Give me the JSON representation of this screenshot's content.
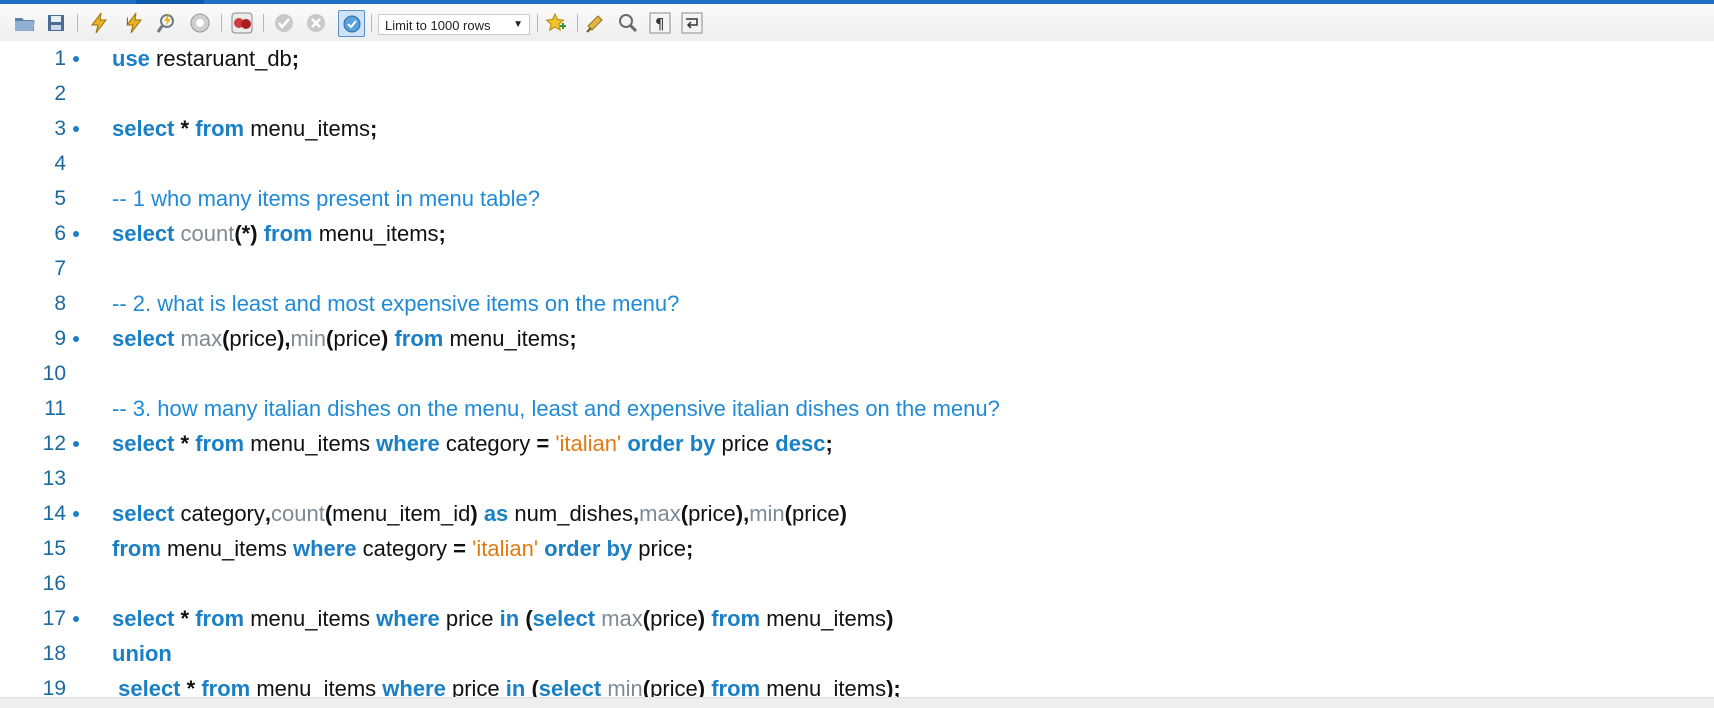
{
  "toolbar": {
    "limit_value": "Limit to 1000 rows",
    "buttons": [
      {
        "icon": "open-folder-icon",
        "label": "Open"
      },
      {
        "icon": "save-icon",
        "label": "Save"
      },
      {
        "icon": "execute-icon",
        "label": "Execute"
      },
      {
        "icon": "execute-current-icon",
        "label": "Execute current"
      },
      {
        "icon": "explain-icon",
        "label": "Explain"
      },
      {
        "icon": "stop-icon",
        "label": "Stop"
      },
      {
        "icon": "toggle-error-icon",
        "label": "Stop on error"
      },
      {
        "icon": "commit-icon",
        "label": "Commit"
      },
      {
        "icon": "rollback-icon",
        "label": "Rollback"
      },
      {
        "icon": "autocommit-icon",
        "label": "Autocommit"
      },
      {
        "icon": "snippet-icon",
        "label": "Add snippet"
      },
      {
        "icon": "beautify-icon",
        "label": "Beautify"
      },
      {
        "icon": "find-icon",
        "label": "Find"
      },
      {
        "icon": "invisible-chars-icon",
        "label": "Invisible characters"
      },
      {
        "icon": "wrap-icon",
        "label": "Word wrap"
      }
    ]
  },
  "colors": {
    "keyword": "#1a80c6",
    "function": "#7e8a93",
    "string": "#e27a12",
    "comment": "#1f8ad6",
    "line_number": "#1a6a9f",
    "accent": "#1f6fc4"
  },
  "editor": {
    "lines": [
      {
        "n": "1",
        "dot": true,
        "tokens": [
          [
            "kw",
            "use"
          ],
          [
            "id",
            " restaruant_db"
          ],
          [
            "pn",
            ";"
          ]
        ]
      },
      {
        "n": "2",
        "dot": false,
        "tokens": []
      },
      {
        "n": "3",
        "dot": true,
        "tokens": [
          [
            "kw",
            "select"
          ],
          [
            "pn",
            " * "
          ],
          [
            "kw",
            "from"
          ],
          [
            "id",
            " menu_items"
          ],
          [
            "pn",
            ";"
          ]
        ]
      },
      {
        "n": "4",
        "dot": false,
        "tokens": []
      },
      {
        "n": "5",
        "dot": false,
        "tokens": [
          [
            "cm",
            "-- 1 who many items present in menu table?"
          ]
        ]
      },
      {
        "n": "6",
        "dot": true,
        "tokens": [
          [
            "kw",
            "select"
          ],
          [
            "id",
            " "
          ],
          [
            "fn",
            "count"
          ],
          [
            "pn",
            "(*)"
          ],
          [
            "id",
            " "
          ],
          [
            "kw",
            "from"
          ],
          [
            "id",
            " menu_items"
          ],
          [
            "pn",
            ";"
          ]
        ]
      },
      {
        "n": "7",
        "dot": false,
        "tokens": []
      },
      {
        "n": "8",
        "dot": false,
        "tokens": [
          [
            "cm",
            "-- 2. what is least and most expensive items on the menu?"
          ]
        ]
      },
      {
        "n": "9",
        "dot": true,
        "tokens": [
          [
            "kw",
            "select"
          ],
          [
            "id",
            " "
          ],
          [
            "fn",
            "max"
          ],
          [
            "pn",
            "("
          ],
          [
            "id",
            "price"
          ],
          [
            "pn",
            "),"
          ],
          [
            "fn",
            "min"
          ],
          [
            "pn",
            "("
          ],
          [
            "id",
            "price"
          ],
          [
            "pn",
            ")"
          ],
          [
            "id",
            " "
          ],
          [
            "kw",
            "from"
          ],
          [
            "id",
            " menu_items"
          ],
          [
            "pn",
            ";"
          ]
        ]
      },
      {
        "n": "10",
        "dot": false,
        "tokens": []
      },
      {
        "n": "11",
        "dot": false,
        "tokens": [
          [
            "cm",
            "-- 3. how many italian dishes on the menu, least and expensive italian dishes on the menu?"
          ]
        ]
      },
      {
        "n": "12",
        "dot": true,
        "tokens": [
          [
            "kw",
            "select"
          ],
          [
            "pn",
            " * "
          ],
          [
            "kw",
            "from"
          ],
          [
            "id",
            " menu_items "
          ],
          [
            "kw",
            "where"
          ],
          [
            "id",
            " category "
          ],
          [
            "pn",
            "="
          ],
          [
            "id",
            " "
          ],
          [
            "str",
            "'italian'"
          ],
          [
            "id",
            " "
          ],
          [
            "kw",
            "order by"
          ],
          [
            "id",
            " price "
          ],
          [
            "kw",
            "desc"
          ],
          [
            "pn",
            ";"
          ]
        ]
      },
      {
        "n": "13",
        "dot": false,
        "tokens": []
      },
      {
        "n": "14",
        "dot": true,
        "tokens": [
          [
            "kw",
            "select"
          ],
          [
            "id",
            " category"
          ],
          [
            "pn",
            ","
          ],
          [
            "fn",
            "count"
          ],
          [
            "pn",
            "("
          ],
          [
            "id",
            "menu_item_id"
          ],
          [
            "pn",
            ")"
          ],
          [
            "id",
            " "
          ],
          [
            "kw",
            "as"
          ],
          [
            "id",
            " num_dishes"
          ],
          [
            "pn",
            ","
          ],
          [
            "fn",
            "max"
          ],
          [
            "pn",
            "("
          ],
          [
            "id",
            "price"
          ],
          [
            "pn",
            "),"
          ],
          [
            "fn",
            "min"
          ],
          [
            "pn",
            "("
          ],
          [
            "id",
            "price"
          ],
          [
            "pn",
            ")"
          ]
        ]
      },
      {
        "n": "15",
        "dot": false,
        "tokens": [
          [
            "kw",
            "from"
          ],
          [
            "id",
            " menu_items "
          ],
          [
            "kw",
            "where"
          ],
          [
            "id",
            " category "
          ],
          [
            "pn",
            "="
          ],
          [
            "id",
            " "
          ],
          [
            "str",
            "'italian'"
          ],
          [
            "id",
            " "
          ],
          [
            "kw",
            "order by"
          ],
          [
            "id",
            " price"
          ],
          [
            "pn",
            ";"
          ]
        ]
      },
      {
        "n": "16",
        "dot": false,
        "tokens": []
      },
      {
        "n": "17",
        "dot": true,
        "tokens": [
          [
            "kw",
            "select"
          ],
          [
            "pn",
            " * "
          ],
          [
            "kw",
            "from"
          ],
          [
            "id",
            " menu_items "
          ],
          [
            "kw",
            "where"
          ],
          [
            "id",
            " price "
          ],
          [
            "kw",
            "in"
          ],
          [
            "id",
            " "
          ],
          [
            "pn",
            "("
          ],
          [
            "kw",
            "select"
          ],
          [
            "id",
            " "
          ],
          [
            "fn",
            "max"
          ],
          [
            "pn",
            "("
          ],
          [
            "id",
            "price"
          ],
          [
            "pn",
            ")"
          ],
          [
            "id",
            " "
          ],
          [
            "kw",
            "from"
          ],
          [
            "id",
            " menu_items"
          ],
          [
            "pn",
            ")"
          ]
        ]
      },
      {
        "n": "18",
        "dot": false,
        "tokens": [
          [
            "kw",
            "union"
          ]
        ]
      },
      {
        "n": "19",
        "dot": false,
        "tokens": [
          [
            "id",
            " "
          ],
          [
            "kw",
            "select"
          ],
          [
            "pn",
            " * "
          ],
          [
            "kw",
            "from"
          ],
          [
            "id",
            " menu_items "
          ],
          [
            "kw",
            "where"
          ],
          [
            "id",
            " price "
          ],
          [
            "kw",
            "in"
          ],
          [
            "id",
            " "
          ],
          [
            "pn",
            "("
          ],
          [
            "kw",
            "select"
          ],
          [
            "id",
            " "
          ],
          [
            "fn",
            "min"
          ],
          [
            "pn",
            "("
          ],
          [
            "id",
            "price"
          ],
          [
            "pn",
            ")"
          ],
          [
            "id",
            " "
          ],
          [
            "kw",
            "from"
          ],
          [
            "id",
            " menu_items"
          ],
          [
            "pn",
            ");"
          ]
        ]
      }
    ]
  }
}
